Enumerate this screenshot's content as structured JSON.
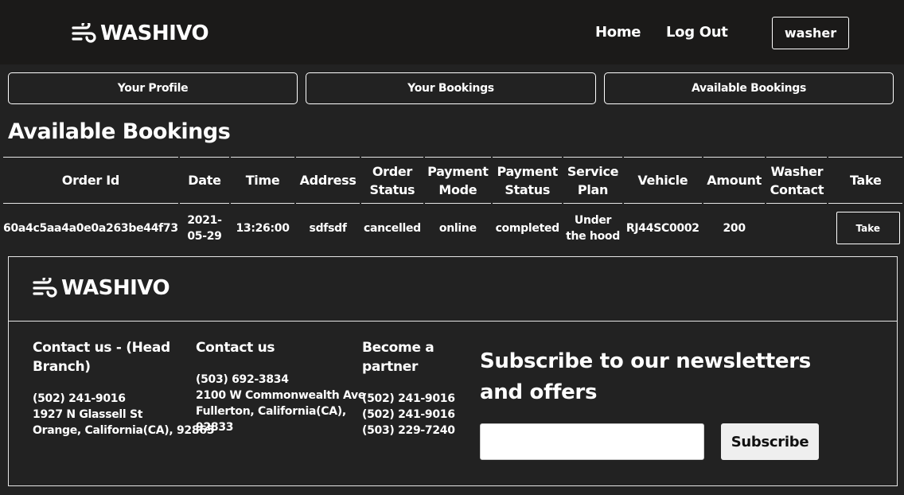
{
  "brand": {
    "name": "WASHIVO"
  },
  "nav": {
    "home": "Home",
    "logout": "Log Out",
    "user": "washer"
  },
  "tabs": [
    "Your Profile",
    "Your Bookings",
    "Available Bookings"
  ],
  "page_title": "Available Bookings",
  "table": {
    "headers": [
      [
        "Order Id"
      ],
      [
        "Date"
      ],
      [
        "Time"
      ],
      [
        "Address"
      ],
      [
        "Order",
        "Status"
      ],
      [
        "Payment",
        "Mode"
      ],
      [
        "Payment",
        "Status"
      ],
      [
        "Service",
        "Plan"
      ],
      [
        "Vehicle"
      ],
      [
        "Amount"
      ],
      [
        "Washer",
        "Contact"
      ],
      [
        "Take"
      ]
    ],
    "rows": [
      {
        "order_id": "60a4c5aa4a0e0a263be44f73",
        "date_line1": "2021-",
        "date_line2": "05-29",
        "time": "13:26:00",
        "address": "sdfsdf",
        "order_status": "cancelled",
        "payment_mode": "online",
        "payment_status": "completed",
        "plan_line1": "Under",
        "plan_line2": "the hood",
        "vehicle": "RJ44SC0002",
        "amount": "200",
        "washer_contact": "",
        "take_label": "Take"
      }
    ]
  },
  "footer": {
    "col1": {
      "head1": "Contact us - (Head",
      "head2": "Branch)",
      "lines": [
        "(502) 241-9016",
        "1927 N Glassell St",
        "Orange, California(CA), 92865"
      ]
    },
    "col2": {
      "head": "Contact us",
      "lines": [
        "(503) 692-3834",
        "2100 W Commonwealth Ave",
        "Fullerton, California(CA),",
        "92833"
      ]
    },
    "col3": {
      "head1": "Become a",
      "head2": "partner",
      "lines": [
        "(502) 241-9016",
        "(502) 241-9016",
        "(503) 229-7240"
      ]
    },
    "subscribe": {
      "title": "Subscribe to our newsletters and offers",
      "input_value": "",
      "button": "Subscribe"
    }
  },
  "icons": {
    "brand_icon": "wind-icon"
  }
}
